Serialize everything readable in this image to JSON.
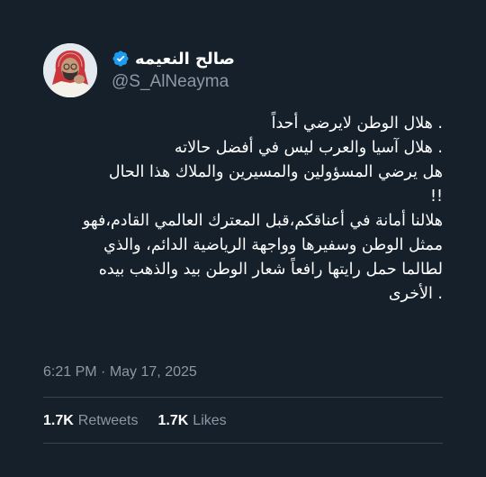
{
  "colors": {
    "background": "#15202b",
    "text_primary": "#ffffff",
    "text_secondary": "#8b98a5",
    "verified": "#1d9bf0",
    "divider": "#38444d"
  },
  "author": {
    "display_name": "صالح النعيمه",
    "handle": "@S_AlNeayma",
    "verified_icon": "verified-badge-icon",
    "avatar": "profile-photo"
  },
  "tweet": {
    "lines": [
      ". هلال الوطن لايرضي أحداً",
      ". هلال آسيا والعرب ليس في أفضل حالاته",
      "هل يرضي المسؤولين والمسيرين والملاك هذا الحال",
      "!!",
      "هلالنا أمانة في أعناقكم،قبل المعترك العالمي القادم،فهو",
      "ممثل الوطن وسفيرها وواجهة الرياضية الدائم، والذي",
      "لطالما حمل رايتها رافعاً شعار الوطن بيد والذهب بيده",
      ". الأخرى"
    ]
  },
  "meta": {
    "time": "6:21 PM",
    "separator": "·",
    "date": "May 17, 2025"
  },
  "stats": {
    "retweets_count": "1.7K",
    "retweets_label": "Retweets",
    "likes_count": "1.7K",
    "likes_label": "Likes"
  }
}
